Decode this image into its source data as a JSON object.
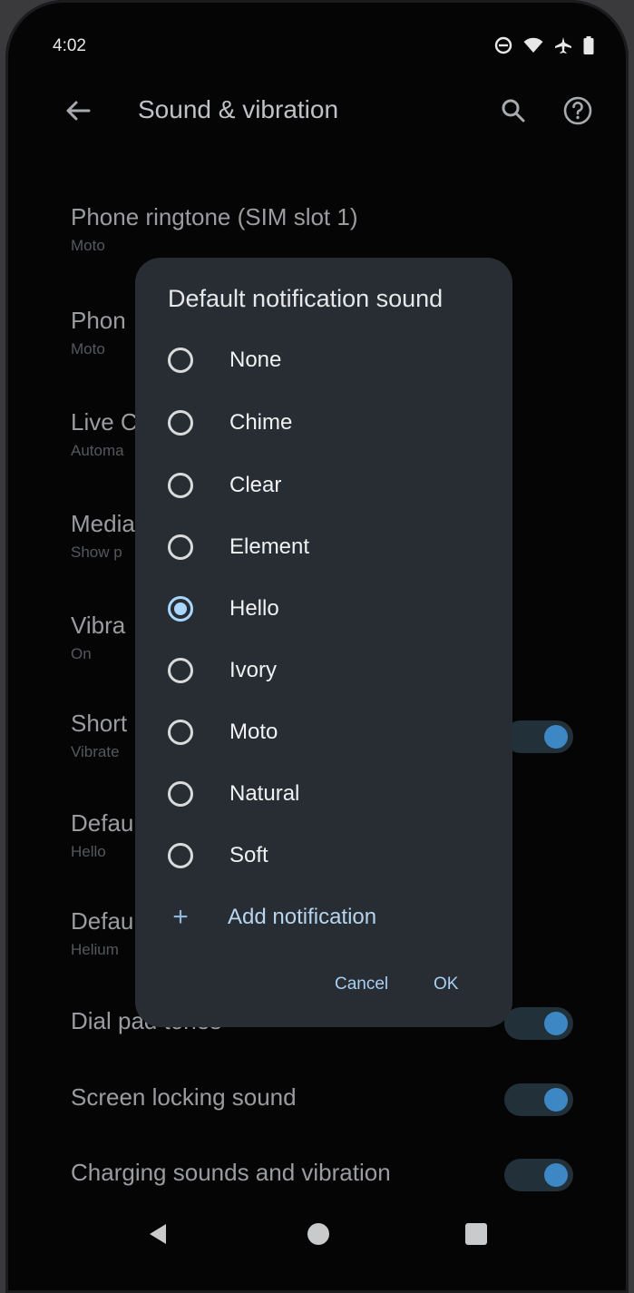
{
  "status_bar": {
    "time": "4:02",
    "icons": [
      "dnd-icon",
      "wifi-icon",
      "airplane-icon",
      "battery-icon"
    ]
  },
  "app_bar": {
    "title": "Sound & vibration",
    "icons": [
      "back-arrow-icon",
      "search-icon",
      "help-icon"
    ]
  },
  "settings": [
    {
      "label": "Phone ringtone (SIM slot 1)",
      "sub": "Moto"
    },
    {
      "label": "Phon",
      "sub": "Moto"
    },
    {
      "label": "Live C",
      "sub": "Automa"
    },
    {
      "label": "Media",
      "sub": "Show p"
    },
    {
      "label": "Vibra",
      "sub": "On"
    },
    {
      "label": "Short",
      "sub": "Vibrate",
      "toggle": true
    },
    {
      "label": "Defau",
      "sub": "Hello"
    },
    {
      "label": "Defau",
      "sub": "Helium"
    },
    {
      "label": "Dial pad tones",
      "sub": "",
      "toggle": true
    },
    {
      "label": "Screen locking sound",
      "sub": "",
      "toggle": true
    },
    {
      "label": "Charging sounds and vibration",
      "sub": "",
      "toggle": true
    }
  ],
  "dialog": {
    "title": "Default notification sound",
    "options": [
      {
        "label": "None",
        "selected": false
      },
      {
        "label": "Chime",
        "selected": false
      },
      {
        "label": "Clear",
        "selected": false
      },
      {
        "label": "Element",
        "selected": false
      },
      {
        "label": "Hello",
        "selected": true
      },
      {
        "label": "Ivory",
        "selected": false
      },
      {
        "label": "Moto",
        "selected": false
      },
      {
        "label": "Natural",
        "selected": false
      },
      {
        "label": "Soft",
        "selected": false
      }
    ],
    "add_label": "Add notification",
    "add_icon": "+",
    "cancel_label": "Cancel",
    "ok_label": "OK"
  },
  "nav_bar": {
    "icons": [
      "nav-back-icon",
      "nav-home-icon",
      "nav-recents-icon"
    ]
  },
  "colors": {
    "accent": "#a9d6ff",
    "dialog_bg": "#272d33",
    "toggle_knob": "#3d87c4"
  }
}
